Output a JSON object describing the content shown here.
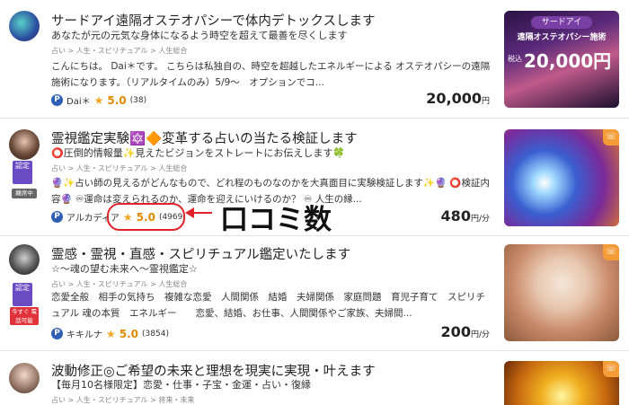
{
  "listings": [
    {
      "title": "サードアイ遠隔オステオパシーで体内デトックスします",
      "subtitle": "あなたが元の元気な身体になるよう時空を超えて最善を尽くします",
      "breadcrumb": "占い > 人生・スピリチュアル > 人生総合",
      "description": "こんにちは。 Dai＊です。 こちらは私独自の、時空を超越したエネルギーによる オステオパシーの遠隔施術になります。（リアルタイムのみ）5/9〜　オプションでコ...",
      "seller": "Dai＊",
      "rating": "5.0",
      "review_count": "(38)",
      "price": "20,000",
      "price_unit": "円",
      "thumb_title": "サードアイ",
      "thumb_subtitle": "遠隔オステオパシー施術",
      "thumb_tax": "税込",
      "thumb_price": "20,000円"
    },
    {
      "title": "霊視鑑定実験🔯🔶変革する占いの当たる検証します",
      "subtitle": "⭕圧倒的情報量✨見えたビジョンをストレートにお伝えします🍀",
      "breadcrumb": "占い > 人生・スピリチュアル > 人生総合",
      "description": "🔮✨占い師の見えるがどんなもので、どれ程のものなのかを大真面目に実験検証します✨🔮 ⭕検証内容🔮 ♾運命は変えられるのか、運命を迎えにいけるのか？ ♾ 人生の縁...",
      "badge_certified": "認定",
      "badge_away": "離席中",
      "seller": "アルカディア",
      "rating": "5.0",
      "review_count": "(4969)",
      "price": "480",
      "price_unit": "円/分"
    },
    {
      "title": "霊感・霊視・直感・スピリチュアル鑑定いたします",
      "subtitle": "☆〜魂の望む未来へ〜霊視鑑定☆",
      "breadcrumb": "占い > 人生・スピリチュアル > 人生総合",
      "description": "恋愛全般　相手の気持ち　複雑な恋愛　人間関係　結婚　夫婦関係　家庭問題　育児子育て　スピリチュアル 魂の本質　エネルギー　　恋愛、結婚、お仕事、人間関係やご家族、夫婦間...",
      "badge_certified": "認定",
      "badge_now": "今すぐ 電話可能",
      "seller": "キキルナ",
      "rating": "5.0",
      "review_count": "(3854)",
      "price": "200",
      "price_unit": "円/分"
    },
    {
      "title": "波動修正◎ご希望の未来と理想を現実に実現・叶えます",
      "subtitle": "【毎月10名様限定】恋愛・仕事・子宝・金運・占い・復縁",
      "breadcrumb": "占い > 人生・スピリチュアル > 将来・未来"
    }
  ],
  "annotation": {
    "label": "口コミ数"
  },
  "icons": {
    "seller_badge": "p-badge-icon",
    "star": "star-icon",
    "phone": "phone-icon"
  },
  "colors": {
    "rating": "#e08a00",
    "badge": "#2f5fb3",
    "annotation": "#e0232b",
    "certified": "#6a4bc4"
  }
}
